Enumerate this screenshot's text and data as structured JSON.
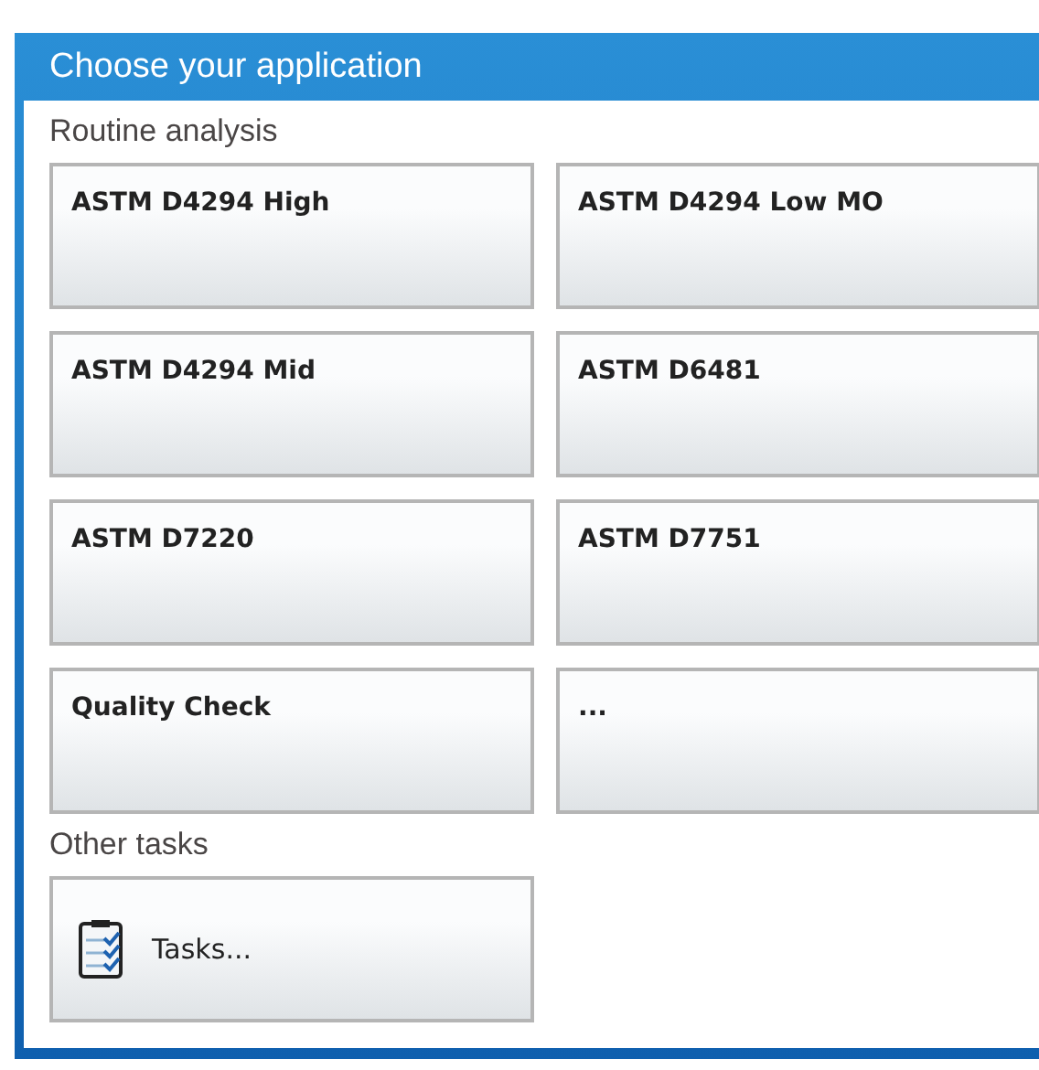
{
  "window": {
    "title": "Choose your application"
  },
  "sections": [
    {
      "label": "Routine analysis",
      "tiles": [
        {
          "label": "ASTM D4294 High",
          "kind": "plain"
        },
        {
          "label": "ASTM D4294 Low MO",
          "kind": "plain"
        },
        {
          "label": "ASTM D4294 Mid",
          "kind": "plain"
        },
        {
          "label": "ASTM D6481",
          "kind": "plain"
        },
        {
          "label": "ASTM D7220",
          "kind": "plain"
        },
        {
          "label": "ASTM D7751",
          "kind": "plain"
        },
        {
          "label": "Quality Check",
          "kind": "plain"
        },
        {
          "label": "...",
          "kind": "plain"
        }
      ]
    },
    {
      "label": "Other tasks",
      "tiles": [
        {
          "label": "Tasks...",
          "kind": "icon"
        }
      ]
    }
  ]
}
